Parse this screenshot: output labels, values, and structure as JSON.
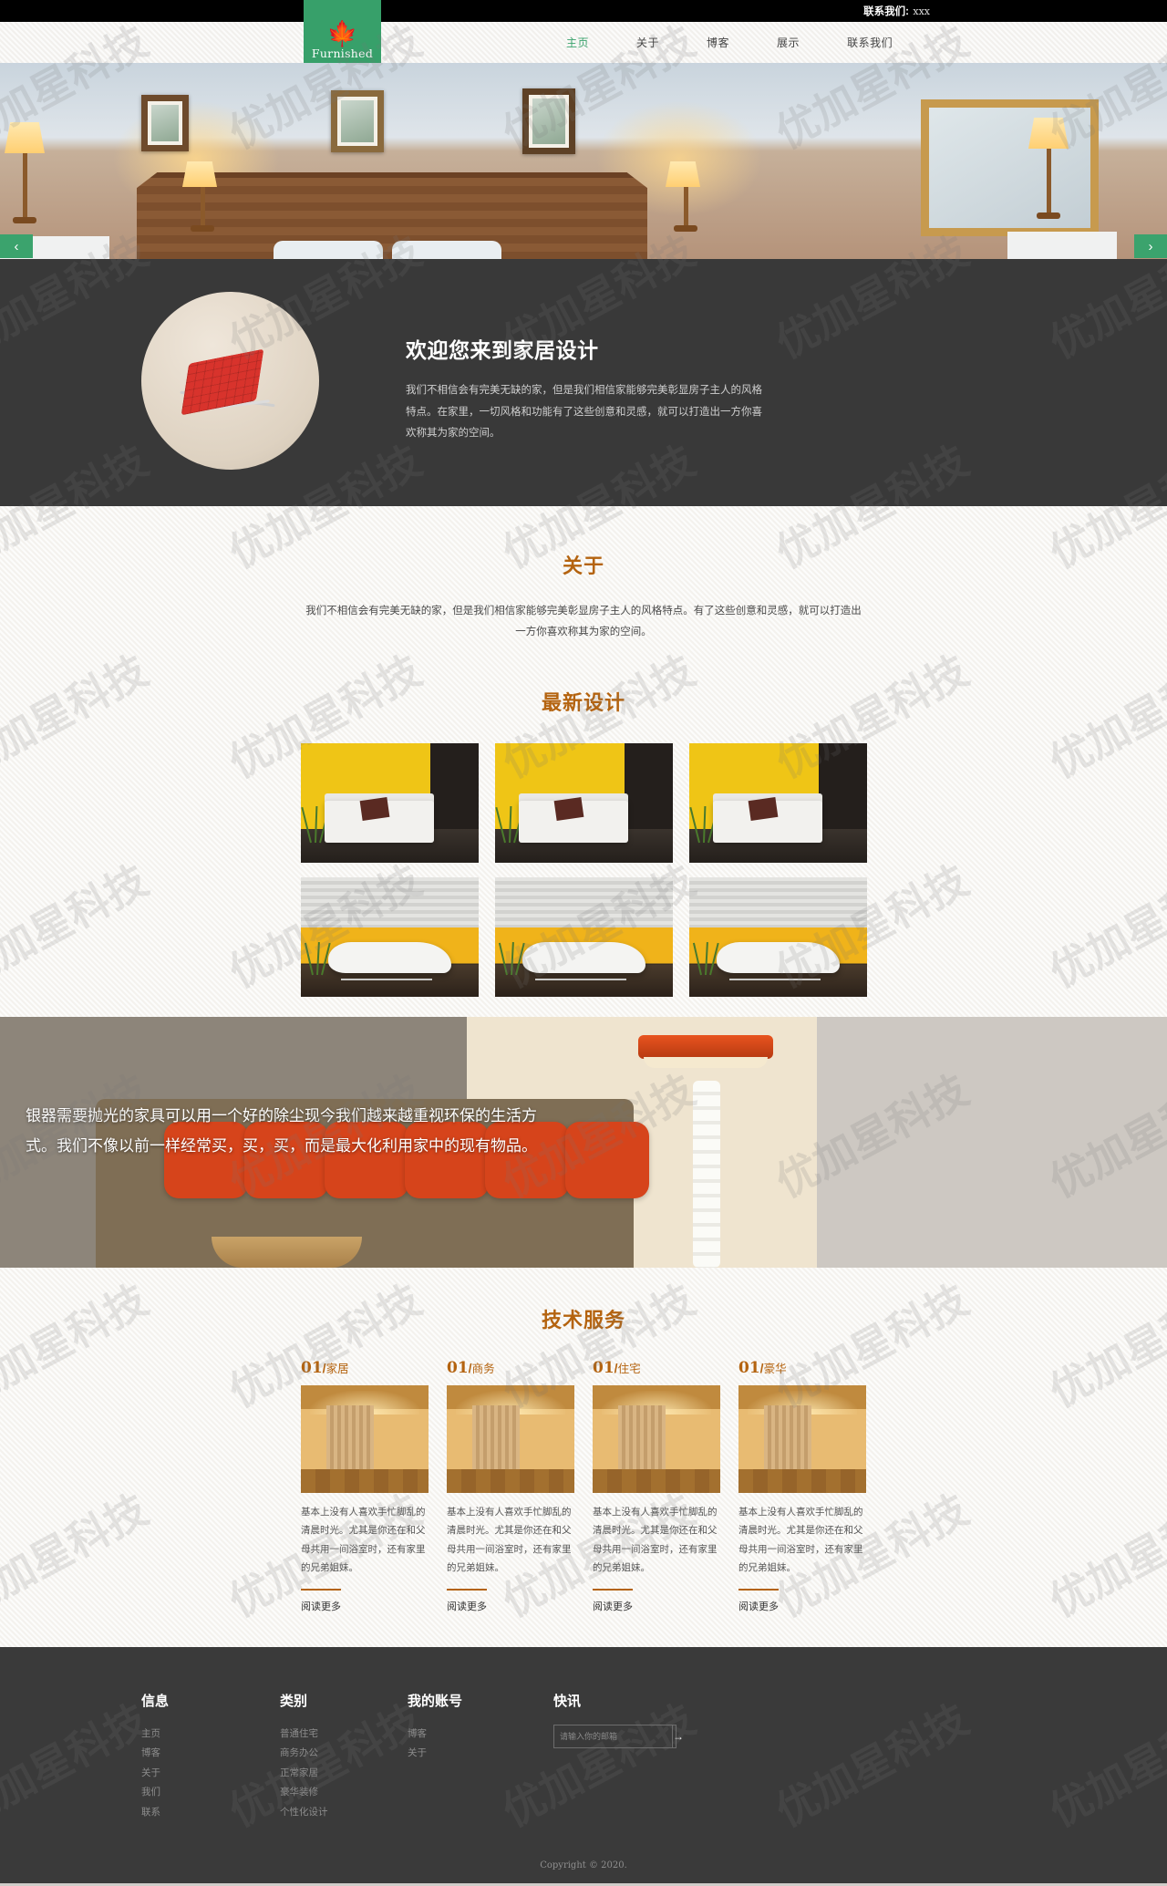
{
  "topbar": {
    "label": "联系我们:",
    "value": "xxx"
  },
  "brand": {
    "name": "Furnished",
    "icon": "leaf-icon",
    "color": "#37a06a"
  },
  "nav": {
    "items": [
      {
        "label": "主页",
        "active": true
      },
      {
        "label": "关于",
        "active": false
      },
      {
        "label": "博客",
        "active": false
      },
      {
        "label": "展示",
        "active": false
      },
      {
        "label": "联系我们",
        "active": false
      }
    ]
  },
  "hero": {
    "prev_icon": "chevron-left-icon",
    "next_icon": "chevron-right-icon",
    "prev_glyph": "‹",
    "next_glyph": "›"
  },
  "welcome": {
    "title": "欢迎您来到家居设计",
    "body": "我们不相信会有完美无缺的家，但是我们相信家能够完美彰显房子主人的风格特点。在家里，一切风格和功能有了这些创意和灵感，就可以打造出一方你喜欢称其为家的空间。"
  },
  "about": {
    "title": "关于",
    "body": "我们不相信会有完美无缺的家，但是我们相信家能够完美彰显房子主人的风格特点。有了这些创意和灵感，就可以打造出一方你喜欢称其为家的空间。"
  },
  "latest": {
    "title": "最新设计",
    "items": [
      {
        "alt": "黄墙白色沙发",
        "style": "a"
      },
      {
        "alt": "黄墙白色沙发",
        "style": "a"
      },
      {
        "alt": "黄墙白色沙发",
        "style": "a"
      },
      {
        "alt": "白色躺椅",
        "style": "b"
      },
      {
        "alt": "白色躺椅",
        "style": "b"
      },
      {
        "alt": "白色躺椅",
        "style": "b"
      }
    ]
  },
  "banner": {
    "text": "银器需要抛光的家具可以用一个好的除尘现今我们越来越重视环保的生活方式。我们不像以前一样经常买，买，买，而是最大化利用家中的现有物品。"
  },
  "services": {
    "title": "技术服务",
    "cards": [
      {
        "num": "01",
        "name": "家居",
        "body": "基本上没有人喜欢手忙脚乱的清晨时光。尤其是你还在和父母共用一间浴室时，还有家里的兄弟姐妹。",
        "more": "阅读更多"
      },
      {
        "num": "01",
        "name": "商务",
        "body": "基本上没有人喜欢手忙脚乱的清晨时光。尤其是你还在和父母共用一间浴室时，还有家里的兄弟姐妹。",
        "more": "阅读更多"
      },
      {
        "num": "01",
        "name": "住宅",
        "body": "基本上没有人喜欢手忙脚乱的清晨时光。尤其是你还在和父母共用一间浴室时，还有家里的兄弟姐妹。",
        "more": "阅读更多"
      },
      {
        "num": "01",
        "name": "豪华",
        "body": "基本上没有人喜欢手忙脚乱的清晨时光。尤其是你还在和父母共用一间浴室时，还有家里的兄弟姐妹。",
        "more": "阅读更多"
      }
    ]
  },
  "footer": {
    "columns": [
      {
        "title": "信息",
        "links": [
          "主页",
          "博客",
          "关于",
          "我们",
          "联系"
        ]
      },
      {
        "title": "类别",
        "links": [
          "普通住宅",
          "商务办公",
          "正常家居",
          "豪华装修",
          "个性化设计"
        ]
      },
      {
        "title": "我的账号",
        "links": [
          "博客",
          "关于"
        ]
      }
    ],
    "news": {
      "title": "快讯",
      "placeholder": "请输入你的邮箱",
      "value": "",
      "submit_icon": "arrow-right-icon",
      "submit_glyph": "→"
    },
    "copyright": "Copyright © 2020."
  },
  "watermark": {
    "text": "优加星科技"
  },
  "theme": {
    "accent": "#b4630f",
    "green": "#3ba36d",
    "dark": "#393939",
    "footer": "#3a3a3a"
  }
}
